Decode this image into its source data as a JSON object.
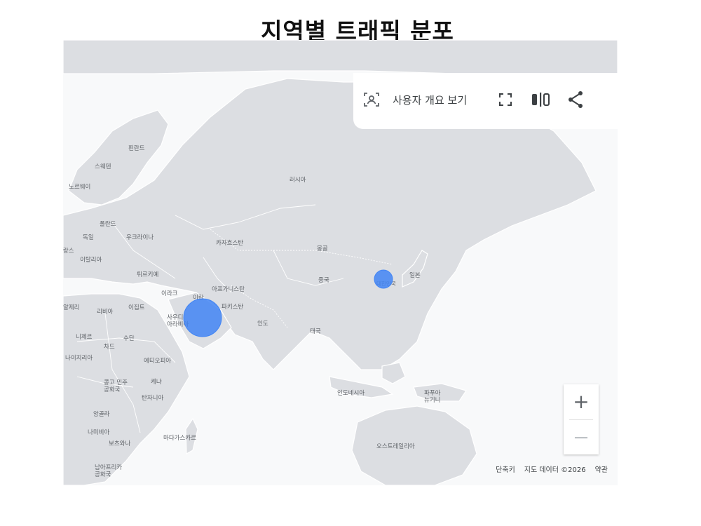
{
  "title": "지역별 트래픽 분포",
  "toolbar": {
    "overview_label": "사용자 개요 보기",
    "icons": [
      "person-frame-icon",
      "fullscreen-icon",
      "split-view-icon",
      "share-icon"
    ]
  },
  "map": {
    "countries": {
      "finland": "핀란드",
      "sweden": "스웨덴",
      "norway": "노르웨이",
      "poland": "폴란드",
      "germany": "독일",
      "ukraine": "우크라이나",
      "france": "프랑스",
      "italy": "이탈리아",
      "turkey": "튀르키예",
      "russia": "러시아",
      "kazakhstan": "카자흐스탄",
      "mongolia": "몽골",
      "china": "중국",
      "korea": "대한민국",
      "japan": "일본",
      "iraq": "이라크",
      "iran": "이란",
      "afghanistan": "아프가니스탄",
      "pakistan": "파키스탄",
      "india": "인도",
      "saudi": "사우디\n아라비아",
      "algeria": "알제리",
      "libya": "리비아",
      "egypt": "이집트",
      "niger": "니제르",
      "chad": "차드",
      "sudan": "수단",
      "nigeria": "나이지리아",
      "ethiopia": "에티오피아",
      "drc": "콩고 민주\n공화국",
      "kenya": "케냐",
      "tanzania": "탄자니아",
      "angola": "앙골라",
      "namibia": "나미비아",
      "botswana": "보츠와나",
      "madagascar": "마다가스카르",
      "south_africa": "남아프리카\n공화국",
      "thailand": "태국",
      "indonesia": "인도네시아",
      "png": "파푸아\n뉴기니",
      "australia": "오스트레일리아"
    },
    "markers": [
      {
        "location": "대한민국",
        "size": "small",
        "color": "#4285f4"
      },
      {
        "location": "이란",
        "size": "large",
        "color": "#4285f4"
      }
    ]
  },
  "zoom": {
    "in_label": "+",
    "out_label": "—"
  },
  "attribution": {
    "shortcuts": "단축키",
    "map_data": "지도 데이터 ©2026",
    "terms": "약관"
  }
}
